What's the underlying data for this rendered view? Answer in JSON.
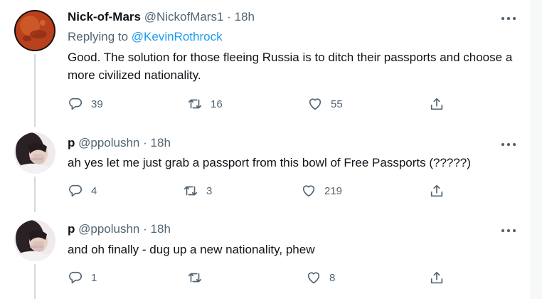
{
  "tweets": [
    {
      "name": "Nick-of-Mars",
      "handle": "@NickofMars1",
      "separator": "·",
      "time": "18h",
      "reply_prefix": "Replying to",
      "reply_handle": "@KevinRothrock",
      "text": "Good. The solution for those fleeing Russia is to ditch their passports and choose a more civilized nationality.",
      "replies": "39",
      "retweets": "16",
      "likes": "55"
    },
    {
      "name": "p",
      "handle": "@ppolushn",
      "separator": "·",
      "time": "18h",
      "text": "ah yes let me just grab a passport from this bowl of Free Passports (?????)",
      "replies": "4",
      "retweets": "3",
      "likes": "219"
    },
    {
      "name": "p",
      "handle": "@ppolushn",
      "separator": "·",
      "time": "18h",
      "text": "and oh finally - dug up a new nationality, phew",
      "replies": "1",
      "retweets": "",
      "likes": "8"
    }
  ],
  "icons": {
    "reply": "reply-icon",
    "retweet": "retweet-icon",
    "like": "heart-icon",
    "share": "share-icon",
    "more": "more-icon"
  },
  "colors": {
    "link": "#1d9bf0",
    "secondary_text": "#536471",
    "thread_line": "#cfd9de",
    "mars_avatar": "#c2461f"
  }
}
